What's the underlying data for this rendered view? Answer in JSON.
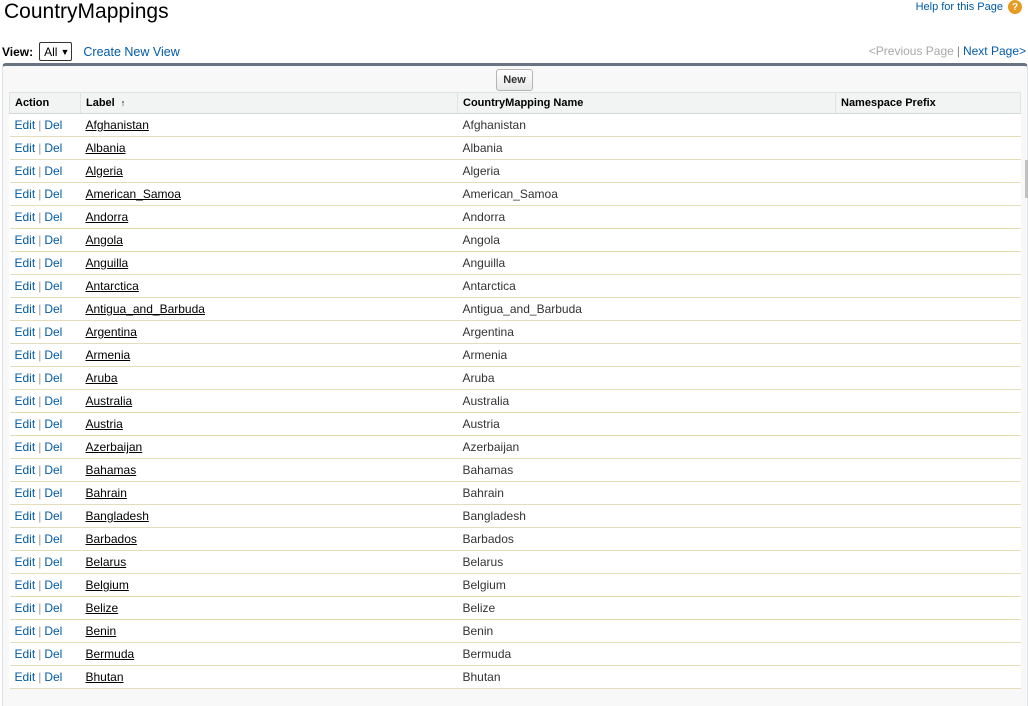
{
  "page": {
    "title": "CountryMappings",
    "help_text": "Help for this Page",
    "help_icon": "?"
  },
  "viewbar": {
    "label": "View:",
    "selected": "All",
    "create_view": "Create New View"
  },
  "pager": {
    "previous": "<Previous Page",
    "separator": "|",
    "next": "Next Page>"
  },
  "toolbar": {
    "new_label": "New"
  },
  "table": {
    "headers": {
      "action": "Action",
      "label": "Label",
      "name": "CountryMapping Name",
      "namespace": "Namespace Prefix"
    },
    "sort_indicator": "↑",
    "edit_label": "Edit",
    "delete_label": "Del",
    "pipe": "|",
    "rows": [
      {
        "label": "Afghanistan",
        "name": "Afghanistan"
      },
      {
        "label": "Albania",
        "name": "Albania"
      },
      {
        "label": "Algeria",
        "name": "Algeria"
      },
      {
        "label": "American_Samoa",
        "name": "American_Samoa"
      },
      {
        "label": "Andorra",
        "name": "Andorra"
      },
      {
        "label": "Angola",
        "name": "Angola"
      },
      {
        "label": "Anguilla",
        "name": "Anguilla"
      },
      {
        "label": "Antarctica",
        "name": "Antarctica"
      },
      {
        "label": "Antigua_and_Barbuda",
        "name": "Antigua_and_Barbuda"
      },
      {
        "label": "Argentina",
        "name": "Argentina"
      },
      {
        "label": "Armenia",
        "name": "Armenia"
      },
      {
        "label": "Aruba",
        "name": "Aruba"
      },
      {
        "label": "Australia",
        "name": "Australia"
      },
      {
        "label": "Austria",
        "name": "Austria"
      },
      {
        "label": "Azerbaijan",
        "name": "Azerbaijan"
      },
      {
        "label": "Bahamas",
        "name": "Bahamas"
      },
      {
        "label": "Bahrain",
        "name": "Bahrain"
      },
      {
        "label": "Bangladesh",
        "name": "Bangladesh"
      },
      {
        "label": "Barbados",
        "name": "Barbados"
      },
      {
        "label": "Belarus",
        "name": "Belarus"
      },
      {
        "label": "Belgium",
        "name": "Belgium"
      },
      {
        "label": "Belize",
        "name": "Belize"
      },
      {
        "label": "Benin",
        "name": "Benin"
      },
      {
        "label": "Bermuda",
        "name": "Bermuda"
      },
      {
        "label": "Bhutan",
        "name": "Bhutan"
      }
    ]
  }
}
